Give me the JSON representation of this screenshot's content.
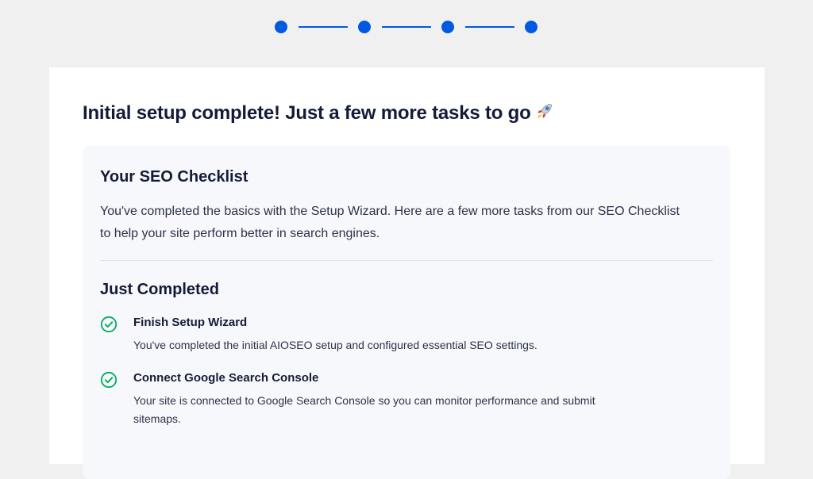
{
  "wizard": {
    "steps": [
      {
        "status": "complete"
      },
      {
        "status": "complete"
      },
      {
        "status": "complete"
      },
      {
        "status": "complete"
      }
    ],
    "accent_color": "#005ae0"
  },
  "page": {
    "title": "Initial setup complete! Just a few more tasks to go",
    "title_icon": "rocket-icon"
  },
  "checklist": {
    "title": "Your SEO Checklist",
    "description": "You've completed the basics with the Setup Wizard. Here are a few more tasks from our SEO Checklist to help your site perform better in search engines.",
    "just_completed": {
      "heading": "Just Completed",
      "tasks": [
        {
          "icon": "check-circle-icon",
          "title": "Finish Setup Wizard",
          "description": "You've completed the initial AIOSEO setup and configured essential SEO settings."
        },
        {
          "icon": "check-circle-icon",
          "title": "Connect Google Search Console",
          "description": "Your site is connected to Google Search Console so you can monitor performance and submit sitemaps."
        }
      ],
      "check_color": "#00aa63"
    }
  }
}
